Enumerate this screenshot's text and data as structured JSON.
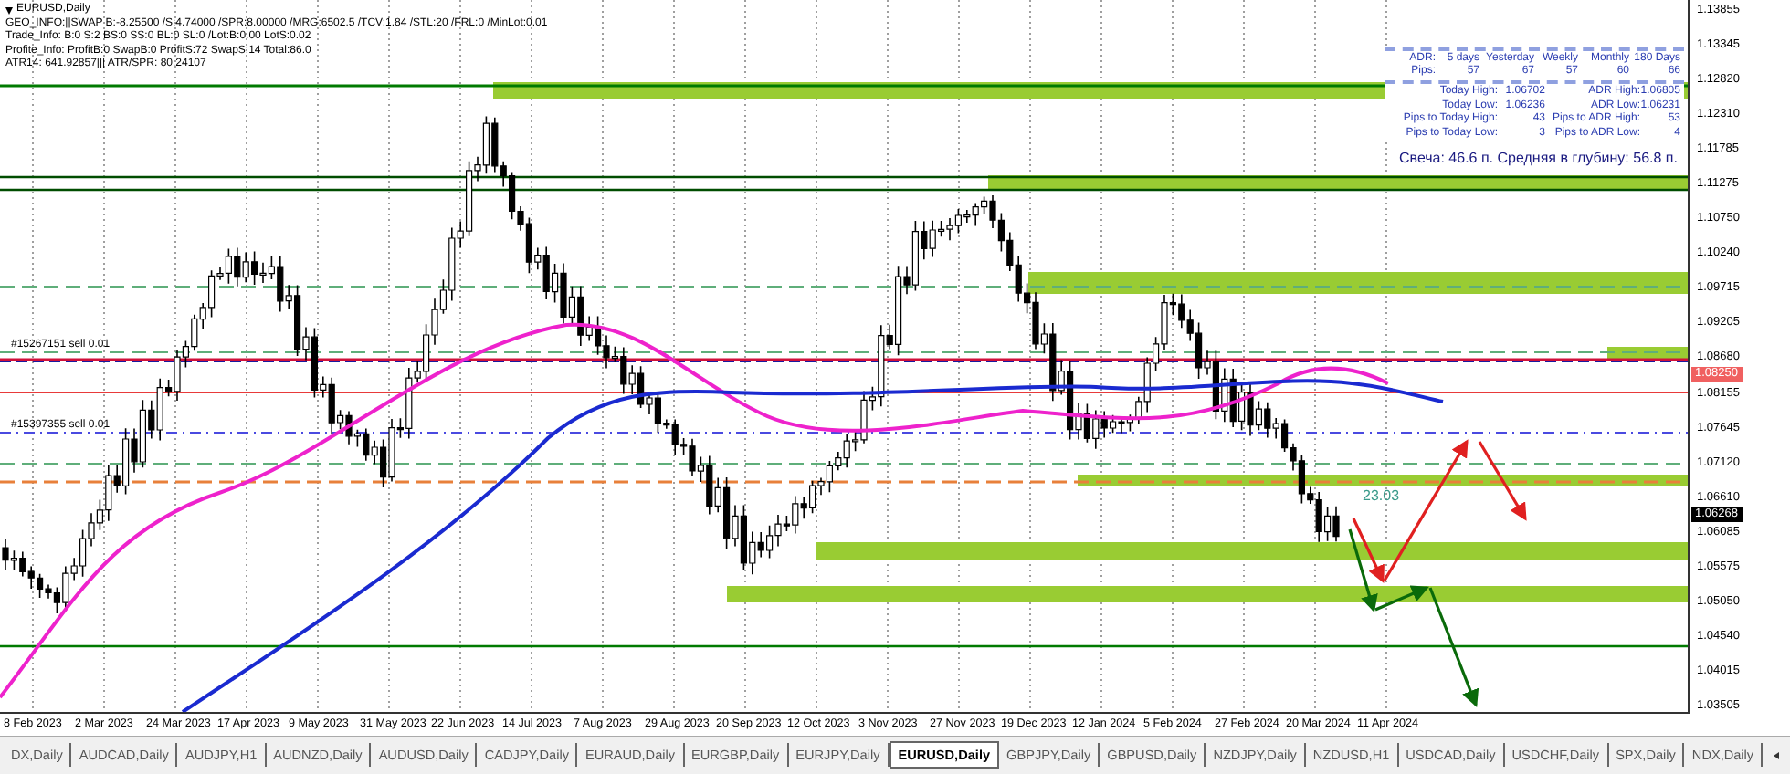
{
  "window": {
    "title": "EURUSD,Daily"
  },
  "info_lines": [
    "GEO_INFO:||SWAP B:-8.25500 /S:4.74000 /SPR:8.00000 /MRG:6502.5 /TCV:1.84 /STL:20 /FRL:0 /MinLot:0.01",
    "Trade_Info: B:0 S:2 BS:0 SS:0 BL:0 SL:0 /Lot:B:0.00 LotS:0.02",
    "Profite_Info: ProfitB:0 SwapB:0 ProfitS:72 SwapS:14 Total:86.0",
    "ATR14: 641.92857||| ATR/SPR: 80.24107"
  ],
  "trade_labels": [
    "#15267151 sell 0.01",
    "#15397355 sell 0.01"
  ],
  "annotation": "23.03",
  "adr_panel": {
    "headers": [
      "ADR:",
      "5 days",
      "Yesterday",
      "Weekly",
      "Monthly",
      "180 Days"
    ],
    "pips": [
      "Pips:",
      "57",
      "67",
      "57",
      "60",
      "66"
    ],
    "stats": [
      {
        "label": "Today High:",
        "value": "1.06702",
        "label2": "ADR High:",
        "value2": "1.06805"
      },
      {
        "label": "Today Low:",
        "value": "1.06236",
        "label2": "ADR Low:",
        "value2": "1.06231"
      },
      {
        "label": "Pips to Today High:",
        "value": "43",
        "label2": "Pips to ADR High:",
        "value2": "53"
      },
      {
        "label": "Pips to Today Low:",
        "value": "3",
        "label2": "Pips to ADR Low:",
        "value2": "4"
      }
    ],
    "summary": "Свеча: 46.6 п. Средняя в глубину: 56.8 п."
  },
  "price_axis": [
    "1.13855",
    "1.13345",
    "1.12820",
    "1.12310",
    "1.11785",
    "1.11275",
    "1.10750",
    "1.10240",
    "1.09715",
    "1.09205",
    "1.08680",
    "1.08155",
    "1.07645",
    "1.07120",
    "1.06610",
    "1.06085",
    "1.05575",
    "1.05050",
    "1.04540",
    "1.04015",
    "1.03505"
  ],
  "price_markers": [
    {
      "price": "1.08250",
      "kind": "line"
    },
    {
      "price": "1.06268",
      "kind": "bid"
    }
  ],
  "date_axis": [
    "8 Feb 2023",
    "2 Mar 2023",
    "24 Mar 2023",
    "17 Apr 2023",
    "9 May 2023",
    "31 May 2023",
    "22 Jun 2023",
    "14 Jul 2023",
    "7 Aug 2023",
    "29 Aug 2023",
    "20 Sep 2023",
    "12 Oct 2023",
    "3 Nov 2023",
    "27 Nov 2023",
    "19 Dec 2023",
    "12 Jan 2024",
    "5 Feb 2024",
    "27 Feb 2024",
    "20 Mar 2024",
    "11 Apr 2024"
  ],
  "tabs": [
    {
      "label": "DX,Daily",
      "selected": false
    },
    {
      "label": "AUDCAD,Daily",
      "selected": false
    },
    {
      "label": "AUDJPY,H1",
      "selected": false
    },
    {
      "label": "AUDNZD,Daily",
      "selected": false
    },
    {
      "label": "AUDUSD,Daily",
      "selected": false
    },
    {
      "label": "CADJPY,Daily",
      "selected": false
    },
    {
      "label": "EURAUD,Daily",
      "selected": false
    },
    {
      "label": "EURGBP,Daily",
      "selected": false
    },
    {
      "label": "EURJPY,Daily",
      "selected": false
    },
    {
      "label": "EURUSD,Daily",
      "selected": true
    },
    {
      "label": "GBPJPY,Daily",
      "selected": false
    },
    {
      "label": "GBPUSD,Daily",
      "selected": false
    },
    {
      "label": "NZDJPY,Daily",
      "selected": false
    },
    {
      "label": "NZDUSD,H1",
      "selected": false
    },
    {
      "label": "USDCAD,Daily",
      "selected": false
    },
    {
      "label": "USDCHF,Daily",
      "selected": false
    },
    {
      "label": "SPX,Daily",
      "selected": false
    },
    {
      "label": "NDX,Daily",
      "selected": false
    }
  ]
}
